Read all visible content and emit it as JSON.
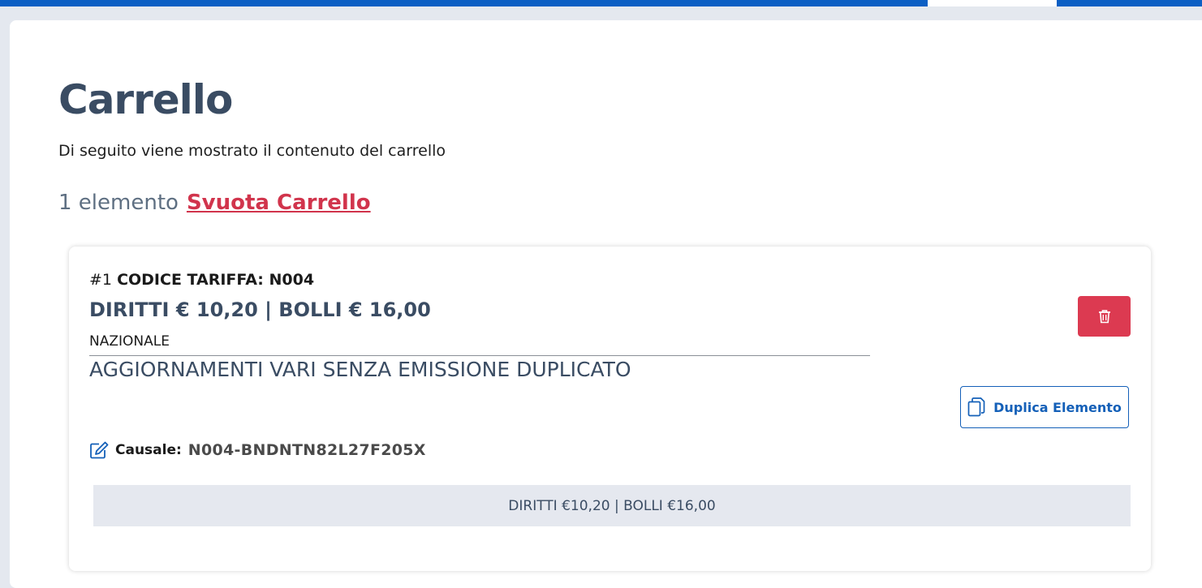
{
  "header": {
    "bar_color": "#0c5fc4"
  },
  "page": {
    "title": "Carrello",
    "subtitle": "Di seguito viene mostrato il contenuto del carrello",
    "count_text": "1 elemento",
    "empty_cart_label": "Svuota Carrello"
  },
  "item": {
    "index": "#1",
    "code_label": "CODICE TARIFFA: N004",
    "amounts": "DIRITTI € 10,20 | BOLLI € 16,00",
    "scope": "NAZIONALE",
    "description": "AGGIORNAMENTI VARI SENZA EMISSIONE DUPLICATO",
    "delete_icon": "trash-icon",
    "duplicate_label": "Duplica Elemento",
    "duplicate_icon": "copy-icon",
    "causale_icon": "edit-icon",
    "causale_label": "Causale:",
    "causale_value": "N004-BNDNTN82L27F205X",
    "summary": "DIRITTI €10,20 | BOLLI €16,00"
  },
  "colors": {
    "primary": "#1460b8",
    "danger": "#dc3a51",
    "heading": "#3a4c63"
  }
}
